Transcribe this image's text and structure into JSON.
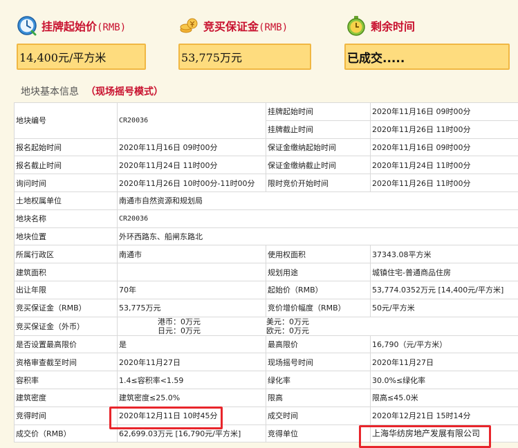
{
  "stats": [
    {
      "icon": "clock-icon",
      "title": "挂牌起始价",
      "title_suffix": "(RMB)",
      "value": "14,400元/平方米"
    },
    {
      "icon": "coins-icon",
      "title": "竞买保证金",
      "title_suffix": "(RMB)",
      "value": "53,775万元"
    },
    {
      "icon": "timer-icon",
      "title": "剩余时间",
      "title_suffix": "",
      "value": "已成交....."
    }
  ],
  "section": {
    "title": "地块基本信息",
    "mode": "（现场摇号模式）"
  },
  "rows": {
    "r1": {
      "l1": "地块编号",
      "v1": "CR20036",
      "l2": "挂牌起始时间",
      "v2": "2020年11月16日 09时00分"
    },
    "r2": {
      "l2": "挂牌截止时间",
      "v2": "2020年11月26日 11时00分"
    },
    "r3": {
      "l1": "报名起始时间",
      "v1": "2020年11月16日 09时00分",
      "l2": "保证金缴纳起始时间",
      "v2": "2020年11月16日 09时00分"
    },
    "r4": {
      "l1": "报名截止时间",
      "v1": "2020年11月24日 11时00分",
      "l2": "保证金缴纳截止时间",
      "v2": "2020年11月24日 11时00分"
    },
    "r5": {
      "l1": "询问时间",
      "v1": "2020年11月26日 10时00分-11时00分",
      "l2": "限时竞价开始时间",
      "v2": "2020年11月26日 11时00分"
    },
    "r6": {
      "l1": "土地权属单位",
      "v1": "南通市自然资源和规划局"
    },
    "r7": {
      "l1": "地块名称",
      "v1": "CR20036"
    },
    "r8": {
      "l1": "地块位置",
      "v1": "外环西路东、船闸东路北"
    },
    "r9": {
      "l1": "所属行政区",
      "v1": "南通市",
      "l2": "使用权面积",
      "v2": "37343.08平方米"
    },
    "r10": {
      "l1": "建筑面积",
      "v1": "",
      "l2": "规划用途",
      "v2": "城镇住宅-普通商品住房"
    },
    "r11": {
      "l1": "出让年限",
      "v1": "70年",
      "l2": "起始价（RMB）",
      "v2": "53,774.0352万元 [14,400元/平方米]"
    },
    "r12": {
      "l1": "竞买保证金（RMB）",
      "v1": "53,775万元",
      "l2": "竞价增价幅度（RMB）",
      "v2": "50元/平方米"
    },
    "r13": {
      "l1": "竞买保证金（外币）",
      "hk": "港币：0万元",
      "jp": "日元：0万元",
      "us": "美元：0万元",
      "eu": "欧元：0万元"
    },
    "r14": {
      "l1": "是否设置最高限价",
      "v1": "是",
      "l2": "最高限价",
      "v2": "16,790（元/平方米）"
    },
    "r15": {
      "l1": "资格审查截至时间",
      "v1": "2020年11月27日",
      "l2": "现场摇号时间",
      "v2": "2020年11月27日"
    },
    "r16": {
      "l1": "容积率",
      "v1": "1.4≤容积率<1.59",
      "l2": "绿化率",
      "v2": "30.0%≤绿化率"
    },
    "r17": {
      "l1": "建筑密度",
      "v1": "建筑密度≤25.0%",
      "l2": "限高",
      "v2": "限高≤45.0米"
    },
    "r18": {
      "l1": "竞得时间",
      "v1": "2020年12月11日 10时45分",
      "l2": "成交时间",
      "v2": "2020年12月21日 15时14分"
    },
    "r19": {
      "l1": "成交价（RMB）",
      "v1": "62,699.03万元 [16,790元/平方米]",
      "l2": "竞得单位",
      "v2": "上海华纺房地产发展有限公司"
    }
  },
  "colors": {
    "accent": "#c8102e",
    "box_bg": "#fedc7e",
    "box_border": "#f0b743",
    "highlight": "#e8252b"
  }
}
